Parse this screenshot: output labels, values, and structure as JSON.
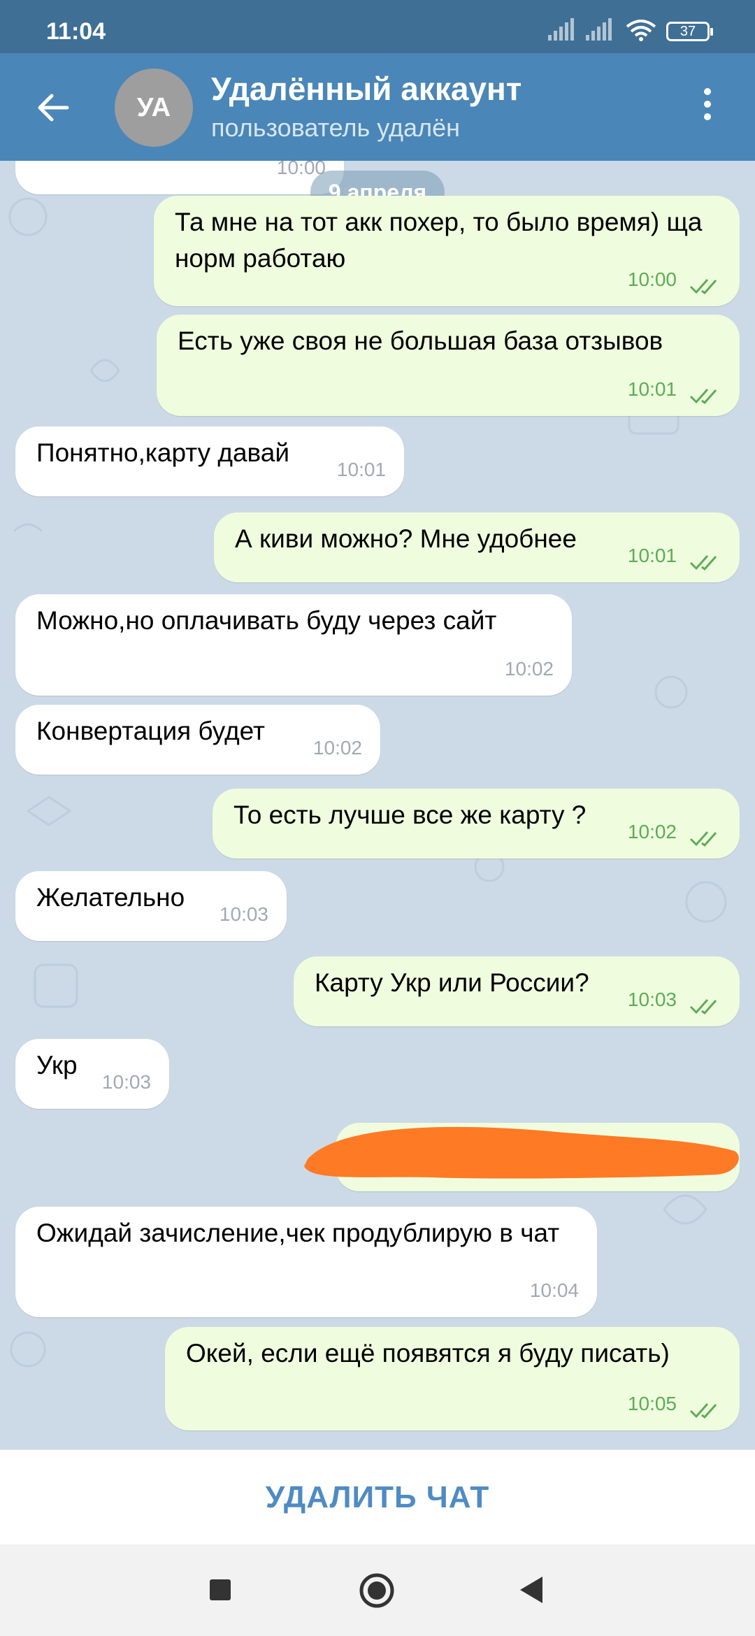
{
  "status_bar": {
    "time": "11:04",
    "battery": "37"
  },
  "header": {
    "avatar_initials": "УА",
    "title": "Удалённый аккаунт",
    "subtitle": "пользователь удалён"
  },
  "chat": {
    "top_partial_time": "10:00",
    "date_label": "9 апреля",
    "messages": [
      {
        "dir": "out",
        "text": "Та мне на тот акк похер, то было время) ща норм работаю",
        "time": "10:00"
      },
      {
        "dir": "out",
        "text": "Есть уже своя не большая база отзывов",
        "time": "10:01"
      },
      {
        "dir": "in",
        "text": "Понятно,карту давай",
        "time": "10:01"
      },
      {
        "dir": "out",
        "text": "А киви можно? Мне удобнее",
        "time": "10:01"
      },
      {
        "dir": "in",
        "text": "Можно,но оплачивать буду через сайт",
        "time": "10:02"
      },
      {
        "dir": "in",
        "text": "Конвертация будет",
        "time": "10:02"
      },
      {
        "dir": "out",
        "text": "То есть лучше все же карту ?",
        "time": "10:02"
      },
      {
        "dir": "in",
        "text": "Желательно",
        "time": "10:03"
      },
      {
        "dir": "out",
        "text": "Карту Укр или России?",
        "time": "10:03"
      },
      {
        "dir": "in",
        "text": "Укр",
        "time": "10:03"
      },
      {
        "dir": "in",
        "text": "Ожидай зачисление,чек продублирую в чат",
        "time": "10:04"
      },
      {
        "dir": "out",
        "text": "Окей, если ещё появятся я буду писать)",
        "time": "10:05"
      }
    ]
  },
  "actions": {
    "delete_chat": "УДАЛИТЬ ЧАТ"
  },
  "colors": {
    "header": "#4a86b7",
    "outgoing_bubble": "#effdde",
    "incoming_bubble": "#ffffff",
    "accent_text": "#4f8bc3",
    "redaction": "#ff7a24"
  },
  "icons": [
    "back-arrow-icon",
    "more-vert-icon",
    "double-check-icon",
    "signal-icon",
    "wifi-icon",
    "battery-icon",
    "nav-recents-icon",
    "nav-home-icon",
    "nav-back-icon"
  ]
}
